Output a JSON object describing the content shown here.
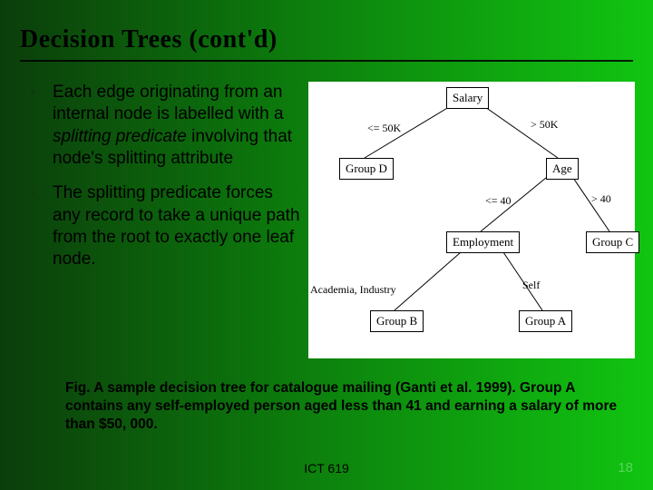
{
  "title": "Decision Trees (cont'd)",
  "bullets": [
    {
      "pre": "Each edge originating from an internal node is labelled with a ",
      "em": "splitting predicate",
      "post": "  involving that node's splitting attribute"
    },
    {
      "pre": "The splitting predicate forces any record to take a unique path from the root to exactly one leaf node.",
      "em": "",
      "post": ""
    }
  ],
  "tree": {
    "nodes": {
      "salary": "Salary",
      "groupD": "Group D",
      "age": "Age",
      "employment": "Employment",
      "groupC": "Group C",
      "groupB": "Group B",
      "groupA": "Group A"
    },
    "edges": {
      "le50k": "<= 50K",
      "gt50k": "> 50K",
      "le40": "<= 40",
      "gt40": "> 40",
      "acad": "Academia, Industry",
      "self": "Self"
    }
  },
  "caption": "Fig. A sample decision tree for catalogue mailing (Ganti et al. 1999). Group A contains any self-employed person aged less than 41 and earning a salary of more than $50, 000.",
  "footer_center": "ICT 619",
  "slide_number": "18"
}
